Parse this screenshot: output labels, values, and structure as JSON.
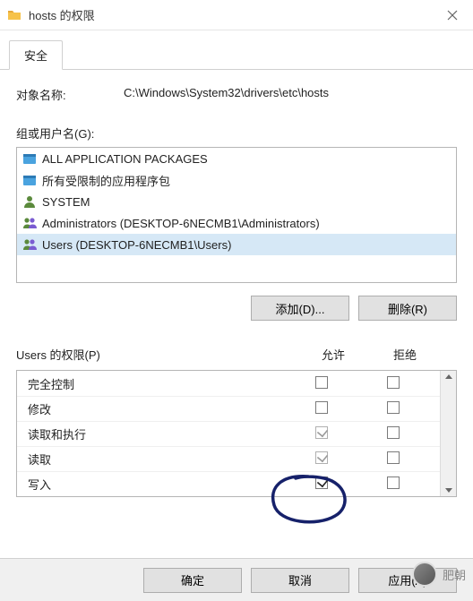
{
  "window": {
    "title": "hosts 的权限"
  },
  "tab": {
    "security": "安全"
  },
  "object": {
    "label": "对象名称:",
    "value": "C:\\Windows\\System32\\drivers\\etc\\hosts"
  },
  "groups": {
    "label": "组或用户名(G):",
    "items": [
      {
        "icon": "package",
        "text": "ALL APPLICATION PACKAGES"
      },
      {
        "icon": "package",
        "text": "所有受限制的应用程序包"
      },
      {
        "icon": "user",
        "text": "SYSTEM"
      },
      {
        "icon": "group",
        "text": "Administrators (DESKTOP-6NECMB1\\Administrators)"
      },
      {
        "icon": "group",
        "text": "Users (DESKTOP-6NECMB1\\Users)",
        "selected": true
      }
    ]
  },
  "buttons": {
    "add": "添加(D)...",
    "remove": "删除(R)",
    "ok": "确定",
    "cancel": "取消",
    "apply": "应用(A)"
  },
  "perms": {
    "header": "Users 的权限(P)",
    "col_allow": "允许",
    "col_deny": "拒绝",
    "rows": [
      {
        "name": "完全控制",
        "allow": "",
        "deny": ""
      },
      {
        "name": "修改",
        "allow": "",
        "deny": ""
      },
      {
        "name": "读取和执行",
        "allow": "checked-dim",
        "deny": ""
      },
      {
        "name": "读取",
        "allow": "checked-dim",
        "deny": ""
      },
      {
        "name": "写入",
        "allow": "checked",
        "deny": ""
      }
    ]
  },
  "overlay": {
    "name": "肥朝"
  }
}
